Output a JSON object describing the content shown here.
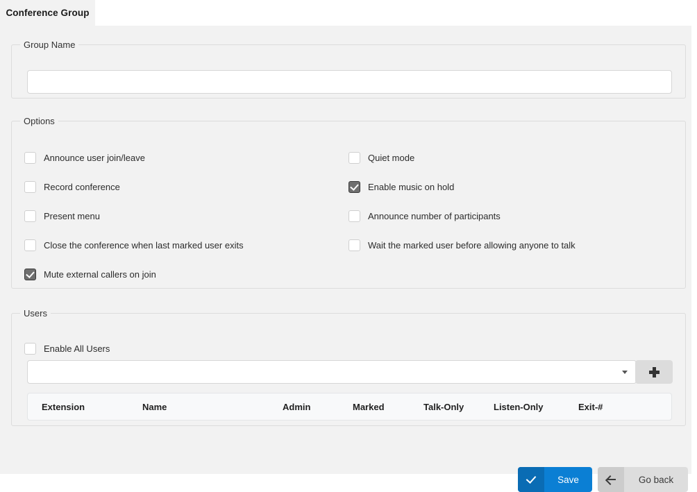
{
  "tab": {
    "label": "Conference Group"
  },
  "group_name": {
    "legend": "Group Name",
    "value": "",
    "placeholder": ""
  },
  "options": {
    "legend": "Options",
    "left_column": [
      {
        "label": "Announce user join/leave",
        "checked": false
      },
      {
        "label": "Record conference",
        "checked": false
      },
      {
        "label": "Present menu",
        "checked": false
      },
      {
        "label": "Close the conference when last marked user exits",
        "checked": false
      },
      {
        "label": "Mute external callers on join",
        "checked": true
      }
    ],
    "right_column": [
      {
        "label": "Quiet mode",
        "checked": false
      },
      {
        "label": "Enable music on hold",
        "checked": true
      },
      {
        "label": "Announce number of participants",
        "checked": false
      },
      {
        "label": "Wait the marked user before allowing anyone to talk",
        "checked": false
      }
    ]
  },
  "users": {
    "legend": "Users",
    "enable_all": {
      "label": "Enable All Users",
      "checked": false
    },
    "select": {
      "value": "",
      "placeholder": ""
    },
    "add_button": {
      "icon": "plus-icon"
    },
    "table": {
      "columns": [
        "Extension",
        "Name",
        "Admin",
        "Marked",
        "Talk-Only",
        "Listen-Only",
        "Exit-#"
      ],
      "rows": []
    }
  },
  "footer": {
    "save": {
      "label": "Save",
      "icon": "check-icon"
    },
    "go_back": {
      "label": "Go back",
      "icon": "arrow-left-icon"
    }
  },
  "colors": {
    "accent": "#0b7fd4",
    "accent_dark": "#0a6cb4",
    "panel_bg": "#f2f2f2",
    "secondary_button": "#dddddd",
    "checkbox_checked": "#6f6f6f"
  }
}
